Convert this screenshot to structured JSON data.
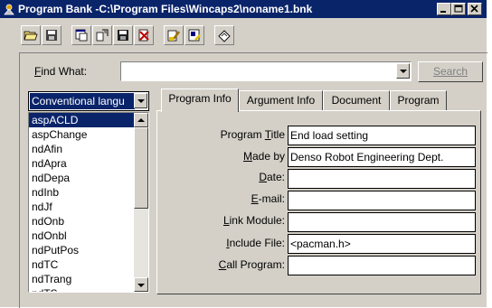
{
  "window": {
    "title": "Program Bank -C:\\Program Files\\Wincaps2\\noname1.bnk",
    "caption_buttons": [
      "minimize-icon",
      "maximize-icon",
      "close-icon"
    ]
  },
  "toolbar": {
    "buttons": [
      "open-folder-icon",
      "save-icon",
      "new-window-icon",
      "copy-icon",
      "save-disk-icon",
      "delete-icon",
      "tool-icon",
      "edit-icon",
      "eraser-icon"
    ]
  },
  "find": {
    "label_pre": "",
    "label_u": "F",
    "label_post": "ind What:",
    "value": "",
    "search_button": "Search"
  },
  "language_dropdown": {
    "value": "Conventional langu"
  },
  "function_list": {
    "items": [
      "aspACLD",
      "aspChange",
      "ndAfin",
      "ndApra",
      "ndDepa",
      "ndInb",
      "ndJf",
      "ndOnb",
      "ndOnbl",
      "ndPutPos",
      "ndTC",
      "ndTrang",
      "ndTS"
    ],
    "selected": "aspACLD"
  },
  "tabs": [
    "Program Info",
    "Argument Info",
    "Document",
    "Program"
  ],
  "active_tab": "Program Info",
  "fields": [
    {
      "pre": "Program ",
      "u": "T",
      "post": "itle",
      "value": "End load setting"
    },
    {
      "pre": "",
      "u": "M",
      "post": "ade by",
      "value": "Denso Robot Engineering Dept."
    },
    {
      "pre": "",
      "u": "D",
      "post": "ate:",
      "value": ""
    },
    {
      "pre": "",
      "u": "E",
      "post": "-mail:",
      "value": ""
    },
    {
      "pre": "",
      "u": "L",
      "post": "ink Module:",
      "value": ""
    },
    {
      "pre": "",
      "u": "I",
      "post": "nclude File:",
      "value": "<pacman.h>"
    },
    {
      "pre": "",
      "u": "C",
      "post": "all Program:",
      "value": ""
    }
  ]
}
